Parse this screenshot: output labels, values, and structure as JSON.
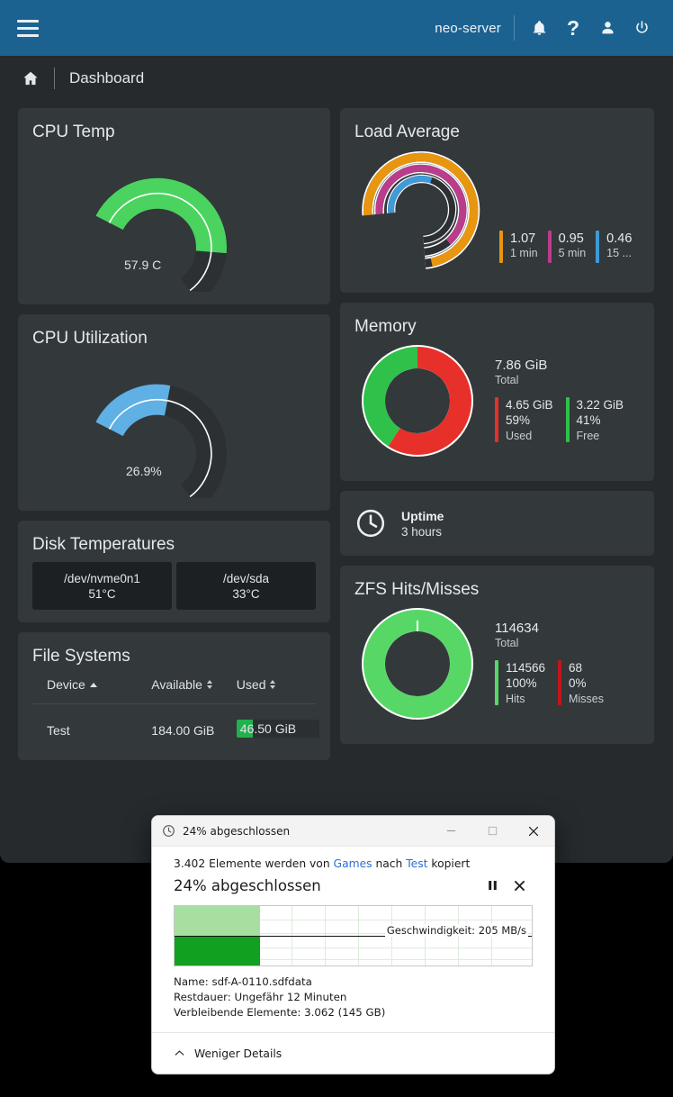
{
  "header": {
    "menu_icon": "hamburger-icon",
    "server_name": "neo-server",
    "icons": [
      "bell-icon",
      "help-icon",
      "user-icon",
      "power-icon"
    ]
  },
  "breadcrumb": {
    "home_icon": "home-icon",
    "title": "Dashboard"
  },
  "cards": {
    "cpu_temp": {
      "title": "CPU Temp",
      "value_label": "57.9 C",
      "value": 57.9,
      "percent": 58,
      "color": "#4ad35f"
    },
    "cpu_util": {
      "title": "CPU Utilization",
      "value_label": "26.9%",
      "value": 26.9,
      "percent": 26.9,
      "color": "#5fb0e5"
    },
    "disk_temps": {
      "title": "Disk Temperatures",
      "disks": [
        {
          "device": "/dev/nvme0n1",
          "temp": "51°C"
        },
        {
          "device": "/dev/sda",
          "temp": "33°C"
        }
      ]
    },
    "file_systems": {
      "title": "File Systems",
      "columns": [
        {
          "label": "Device",
          "sort": "asc"
        },
        {
          "label": "Available",
          "sort": "none"
        },
        {
          "label": "Used",
          "sort": "none"
        }
      ],
      "rows": [
        {
          "device": "Test",
          "available": "184.00 GiB",
          "used": "46.50 GiB",
          "used_percent": 20
        }
      ]
    },
    "load_average": {
      "title": "Load Average",
      "entries": [
        {
          "value": "1.07",
          "label": "1 min",
          "color": "#e8960f"
        },
        {
          "value": "0.95",
          "label": "5 min",
          "color": "#b93d8a"
        },
        {
          "value": "0.46",
          "label": "15 ...",
          "color": "#3f9ad8"
        }
      ]
    },
    "memory": {
      "title": "Memory",
      "total_value": "7.86 GiB",
      "total_label": "Total",
      "segments": [
        {
          "value": "4.65 GiB",
          "percent_label": "59%",
          "label": "Used",
          "percent": 59,
          "color": "#e8302a"
        },
        {
          "value": "3.22 GiB",
          "percent_label": "41%",
          "label": "Free",
          "percent": 41,
          "color": "#2fc14a"
        }
      ]
    },
    "uptime": {
      "icon": "clock-icon",
      "title": "Uptime",
      "value": "3 hours"
    },
    "zfs": {
      "title": "ZFS Hits/Misses",
      "total_value": "114634",
      "total_label": "Total",
      "segments": [
        {
          "value": "114566",
          "percent_label": "100%",
          "label": "Hits",
          "percent": 99.94,
          "color": "#57d866"
        },
        {
          "value": "68",
          "percent_label": "0%",
          "label": "Misses",
          "percent": 0.06,
          "color": "#c0161a"
        }
      ]
    }
  },
  "copy_dialog": {
    "title_icon": "clock-icon",
    "title": "24% abgeschlossen",
    "minimize_label": "—",
    "maximize_label": "□",
    "close_label": "✕",
    "summary_prefix": "3.402 Elemente werden von ",
    "summary_source": "Games",
    "summary_middle": " nach ",
    "summary_target": "Test",
    "summary_suffix": " kopiert",
    "percent_text": "24% abgeschlossen",
    "percent": 24,
    "pause_icon": "pause-icon",
    "cancel_icon": "close-icon",
    "speed_text": "Geschwindigkeit: 205 MB/s",
    "meta": [
      {
        "label": "Name:",
        "value": "sdf-A-0110.sdfdata"
      },
      {
        "label": "Restdauer:",
        "value": "Ungefähr 12 Minuten"
      },
      {
        "label": "Verbleibende Elemente:",
        "value": "3.062 (145 GB)"
      }
    ],
    "details_toggle_icon": "chevron-up-icon",
    "details_toggle_label": "Weniger Details"
  },
  "colors": {
    "header_blue": "#1c6291",
    "card_bg": "#33383b",
    "page_bg": "#262a2d",
    "green": "#4ad35f",
    "blue": "#5fb0e5",
    "red": "#e8302a"
  }
}
